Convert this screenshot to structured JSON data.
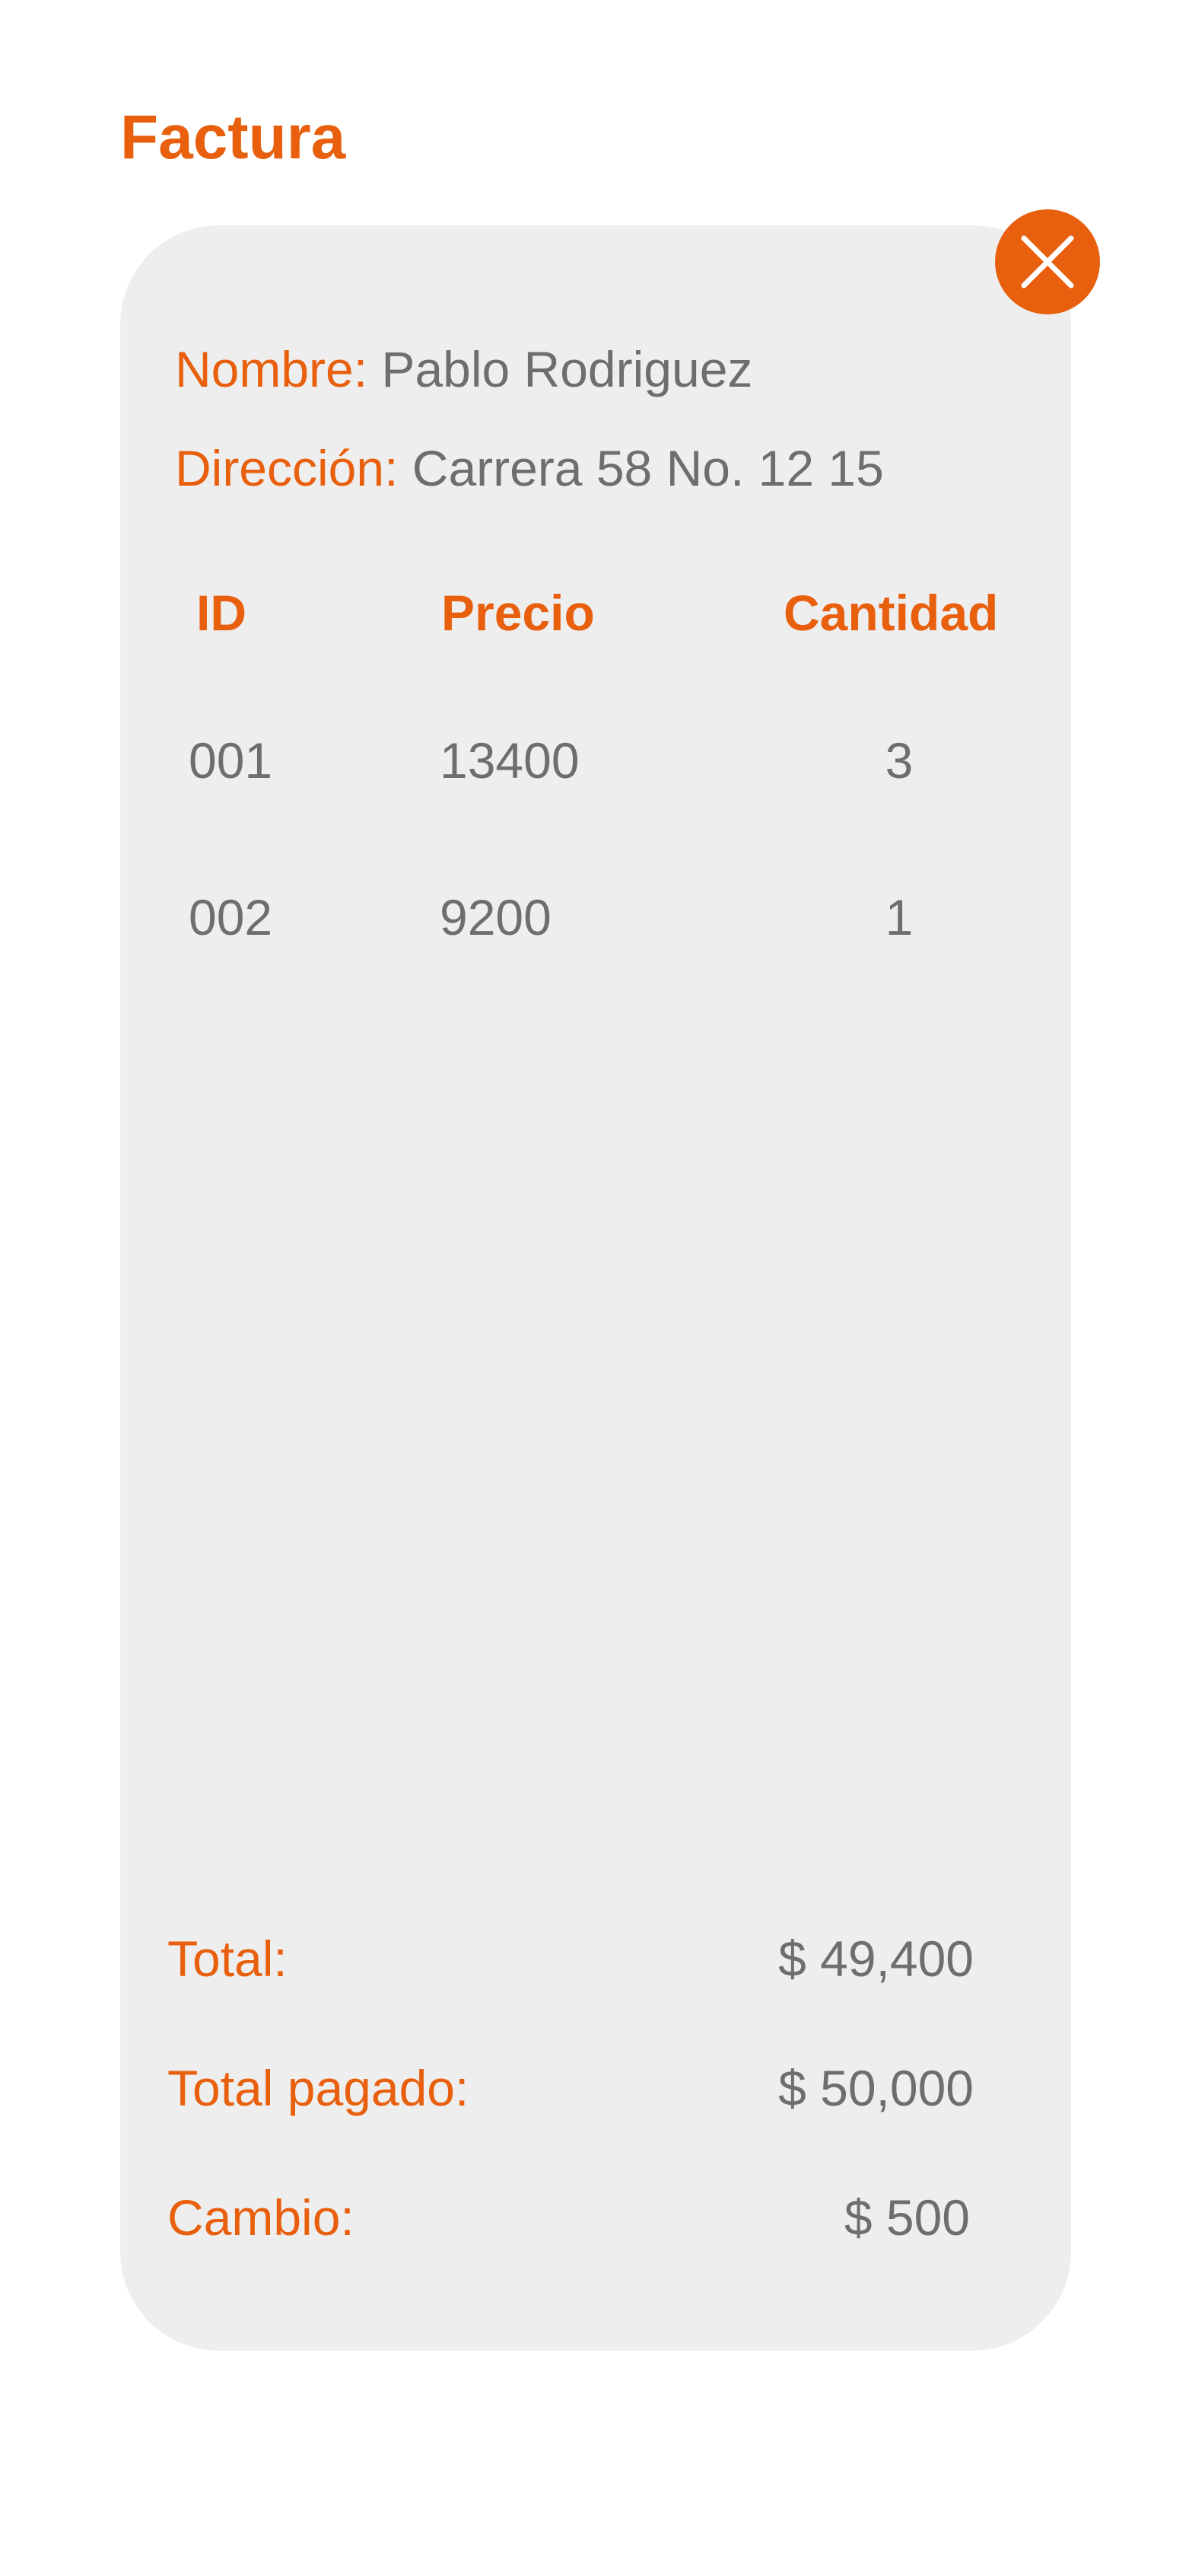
{
  "header": {
    "title": "Factura"
  },
  "close_icon": "close-icon",
  "customer": {
    "name_label": "Nombre:",
    "name_value": "Pablo Rodriguez",
    "address_label": "Dirección:",
    "address_value": "Carrera 58 No. 12 15"
  },
  "table": {
    "headers": [
      "ID",
      "Precio",
      "Cantidad"
    ],
    "rows": [
      [
        "001",
        "13400",
        "3"
      ],
      [
        "002",
        "9200",
        "1"
      ]
    ]
  },
  "summary": {
    "total_label": "Total:",
    "total_value": "$ 49,400",
    "paid_label": "Total pagado:",
    "paid_value": "$ 50,000",
    "change_label": "Cambio:",
    "change_value": "$ 500"
  },
  "colors": {
    "accent": "#e8600e",
    "text": "#6e6e6e",
    "card": "#efeeef"
  }
}
